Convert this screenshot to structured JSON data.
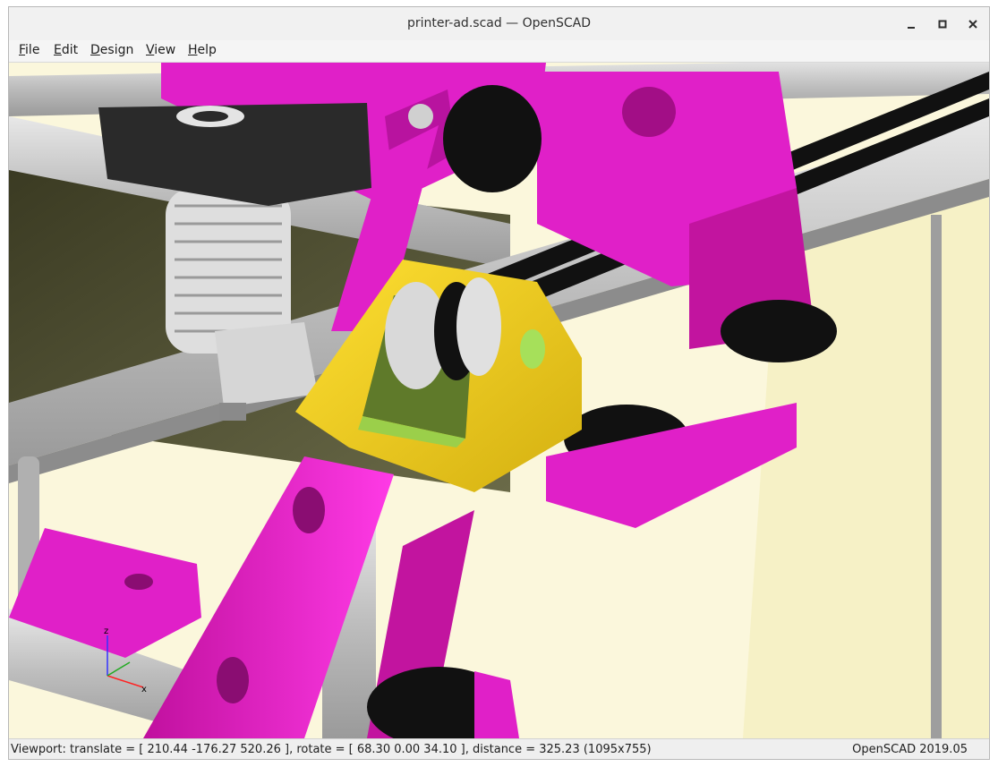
{
  "window": {
    "title": "printer-ad.scad — OpenSCAD",
    "controls": {
      "minimize_icon": "minimize-icon",
      "maximize_icon": "maximize-icon",
      "close_icon": "close-icon"
    }
  },
  "menubar": {
    "items": [
      {
        "label_first": "F",
        "label_rest": "ile"
      },
      {
        "label_first": "E",
        "label_rest": "dit"
      },
      {
        "label_first": "D",
        "label_rest": "esign"
      },
      {
        "label_first": "V",
        "label_rest": "iew"
      },
      {
        "label_first": "H",
        "label_rest": "elp"
      }
    ]
  },
  "viewport": {
    "axis_labels": {
      "z": "z",
      "x": "x"
    },
    "colors": {
      "background": "#fbf7dc",
      "frame_parts": "#e020c8",
      "idler_bracket": "#f2d21e",
      "hotend": "#d8d8d8",
      "belts_feet": "#111111",
      "aluminium_extrusion": "#c8c8c8",
      "print_bed": "#4f4f2e"
    }
  },
  "statusbar": {
    "viewport_info": "Viewport: translate = [ 210.44 -176.27 520.26 ], rotate = [ 68.30 0.00 34.10 ], distance = 325.23 (1095x755)",
    "version": "OpenSCAD 2019.05"
  }
}
